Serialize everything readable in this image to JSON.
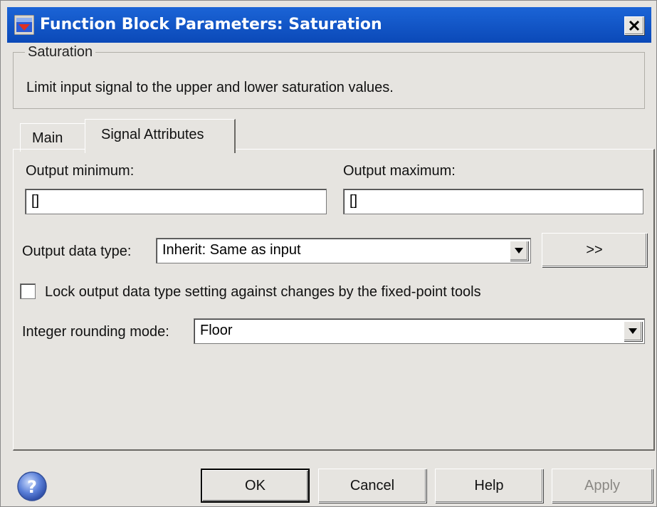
{
  "window": {
    "title": "Function Block Parameters: Saturation",
    "icon": "simulink-block-icon",
    "close_icon": "close-icon"
  },
  "block": {
    "group_label": "Saturation",
    "description": "Limit input signal to the upper and lower saturation values."
  },
  "tabs": [
    {
      "label": "Main",
      "active": false
    },
    {
      "label": "Signal Attributes",
      "active": true
    }
  ],
  "signal_attributes": {
    "output_minimum_label": "Output minimum:",
    "output_minimum_value": "[]",
    "output_maximum_label": "Output maximum:",
    "output_maximum_value": "[]",
    "output_data_type_label": "Output data type:",
    "output_data_type_value": "Inherit: Same as input",
    "data_type_assistant_label": ">>",
    "lock_checkbox_label": "Lock output data type setting against changes by the fixed-point tools",
    "lock_checked": false,
    "rounding_label": "Integer rounding mode:",
    "rounding_value": "Floor"
  },
  "buttons": {
    "ok": "OK",
    "cancel": "Cancel",
    "help": "Help",
    "apply": "Apply"
  },
  "colors": {
    "titlebar": "#0b49b8",
    "dialog_background": "#e6e4e0"
  }
}
